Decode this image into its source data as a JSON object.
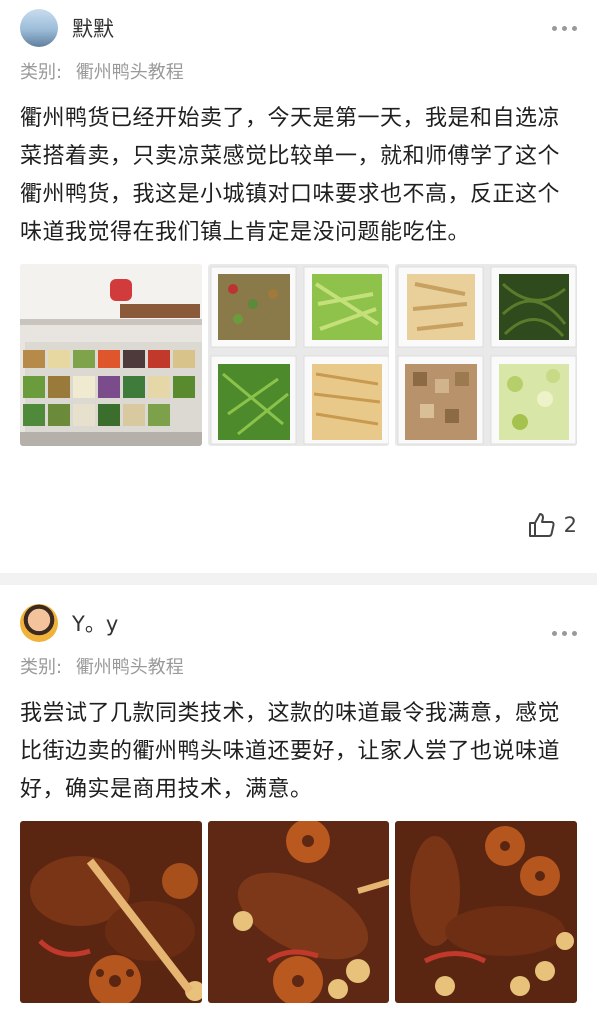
{
  "posts": [
    {
      "username": "默默",
      "category_label": "类别:",
      "category_value": "衢州鸭头教程",
      "content": "衢州鸭货已经开始卖了，今天是第一天，我是和自选凉菜搭着卖，只卖凉菜感觉比较单一，就和师傅学了这个衢州鸭货，我这是小城镇对口味要求也不高，反正这个味道我觉得在我们镇上肯定是没问题能吃住。",
      "likes": "2",
      "images": [
        "cold-dish-counter-photo",
        "vegetable-tubs-photo-1",
        "vegetable-tubs-photo-2"
      ]
    },
    {
      "username": "Y。y",
      "category_label": "类别:",
      "category_value": "衢州鸭头教程",
      "content": "我尝试了几款同类技术，这款的味道最令我满意，感觉比街边卖的衢州鸭头味道还要好，让家人尝了也说味道好，确实是商用技术，满意。",
      "images": [
        "braised-duck-head-photo-1",
        "braised-duck-head-photo-2",
        "braised-duck-head-photo-3"
      ]
    }
  ],
  "icons": [
    "more-dots-icon",
    "thumbs-up-icon"
  ]
}
